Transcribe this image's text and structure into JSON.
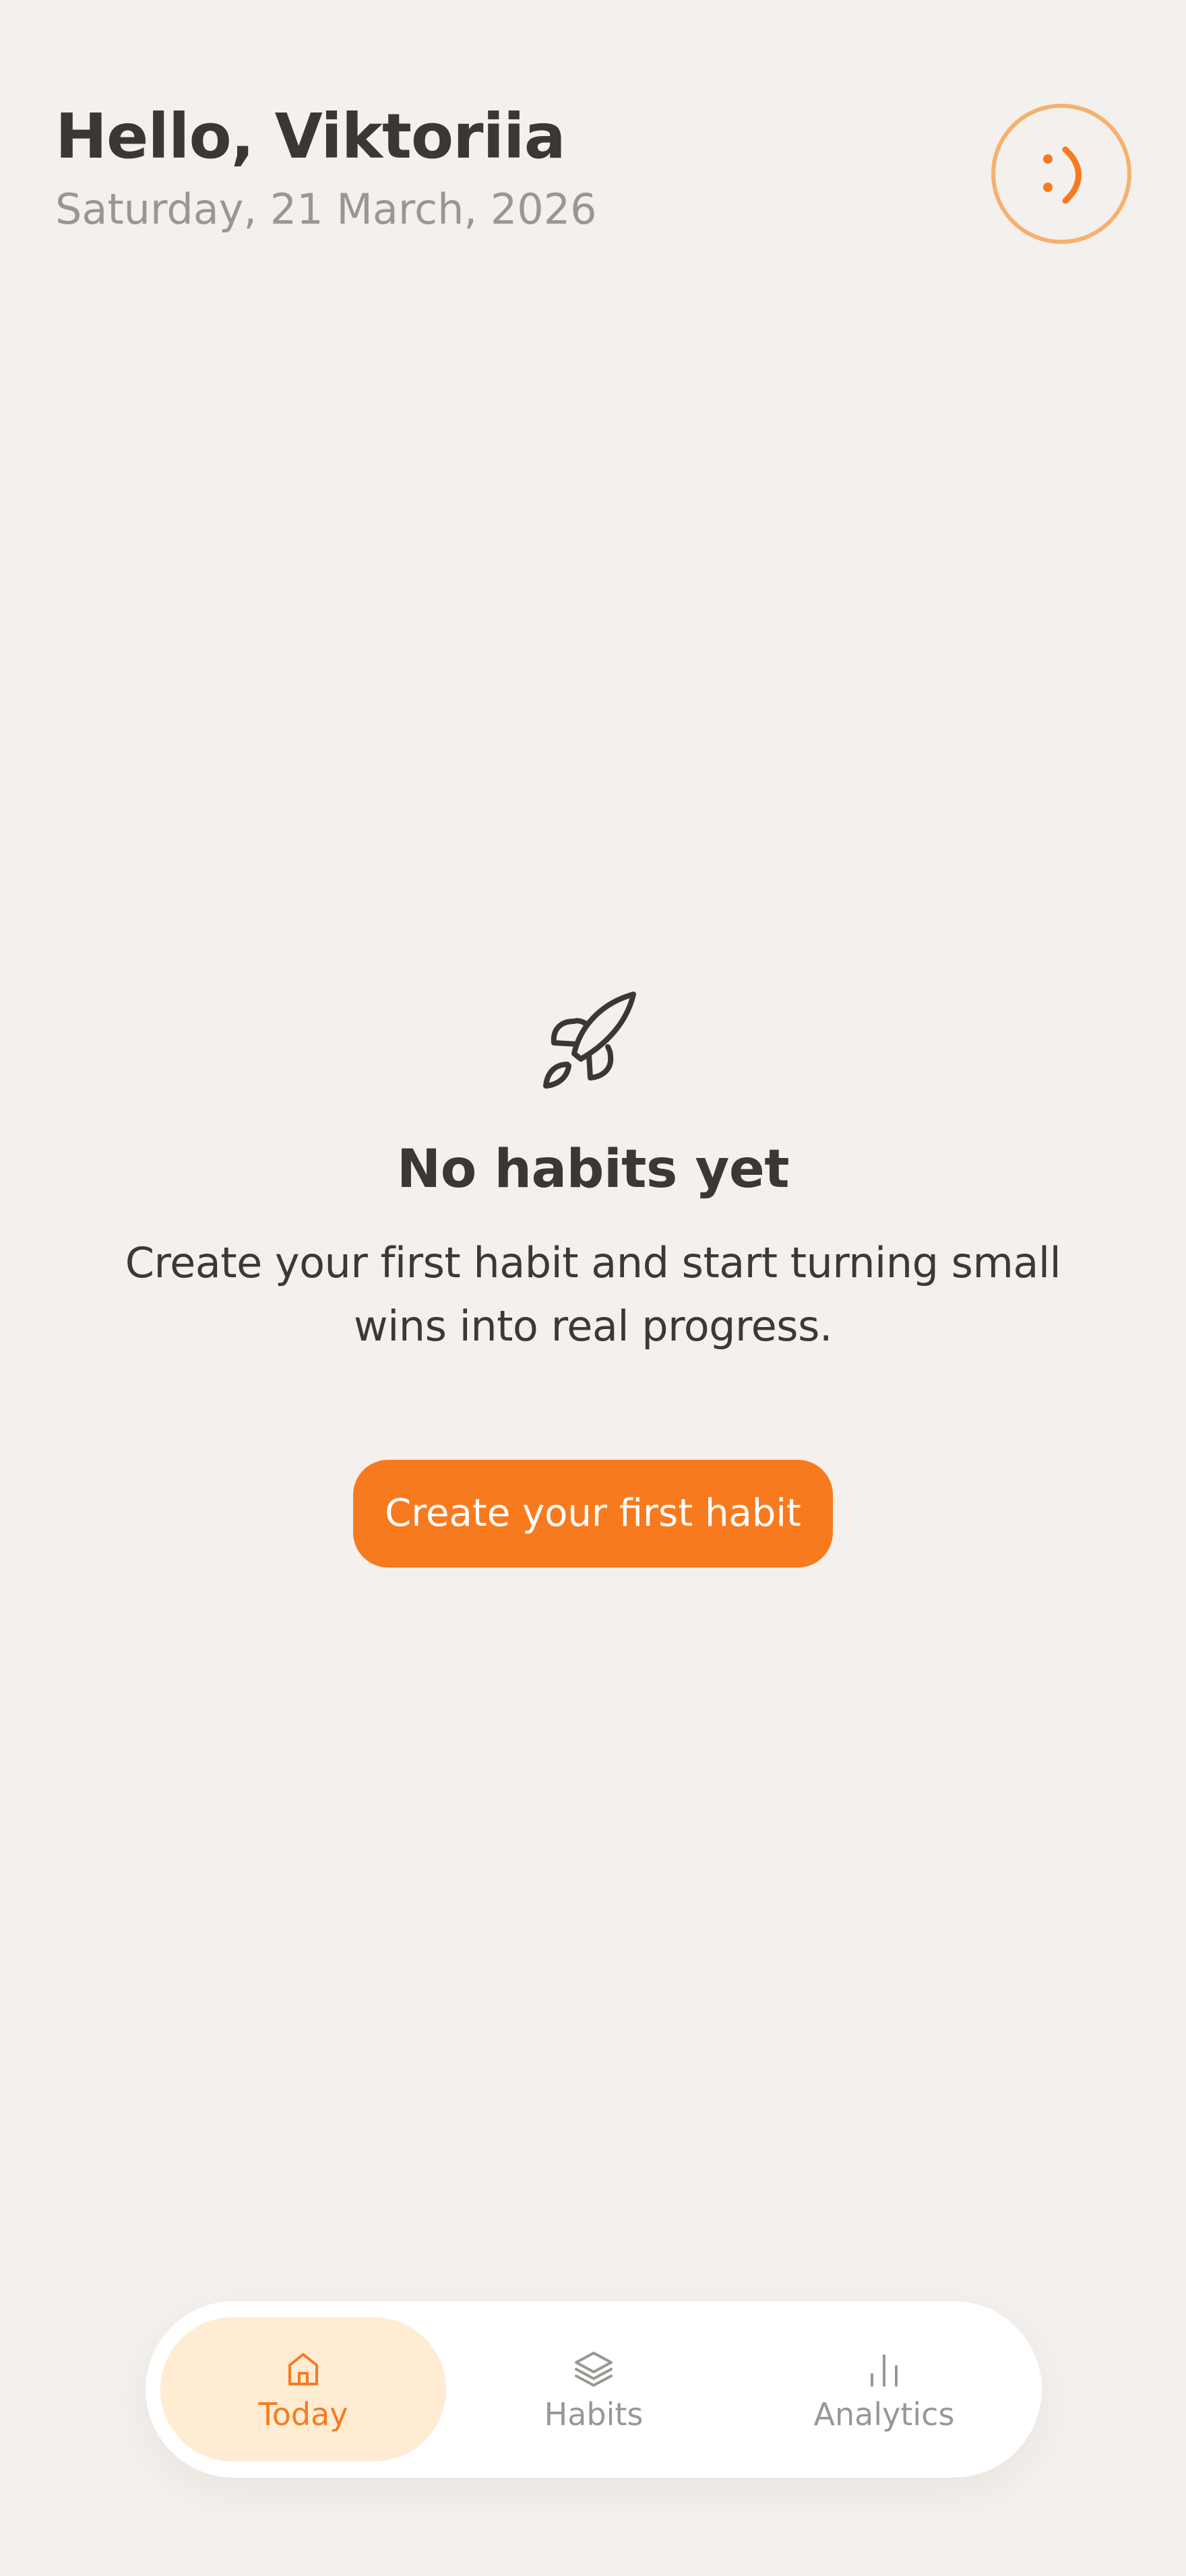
{
  "header": {
    "greeting": "Hello, Viktoriia",
    "date": "Saturday, 21 March, 2026"
  },
  "profile_button": {
    "icon": "smiley-icon"
  },
  "empty_state": {
    "icon": "rocket-icon",
    "title": "No habits yet",
    "description": "Create your first habit and start turning small wins into real progress.",
    "button_label": "Create your first habit"
  },
  "bottom_nav": {
    "items": [
      {
        "label": "Today",
        "icon": "home-icon",
        "active": true
      },
      {
        "label": "Habits",
        "icon": "layers-icon",
        "active": false
      },
      {
        "label": "Analytics",
        "icon": "bar-chart-icon",
        "active": false
      }
    ]
  },
  "colors": {
    "background": "#f4f0ed",
    "accent": "#f77a1f",
    "accent_light": "#ffecd3",
    "profile_ring": "#f6b06f",
    "text_primary": "#3a3833",
    "text_muted": "#9a9692",
    "nav_background": "#ffffff"
  }
}
